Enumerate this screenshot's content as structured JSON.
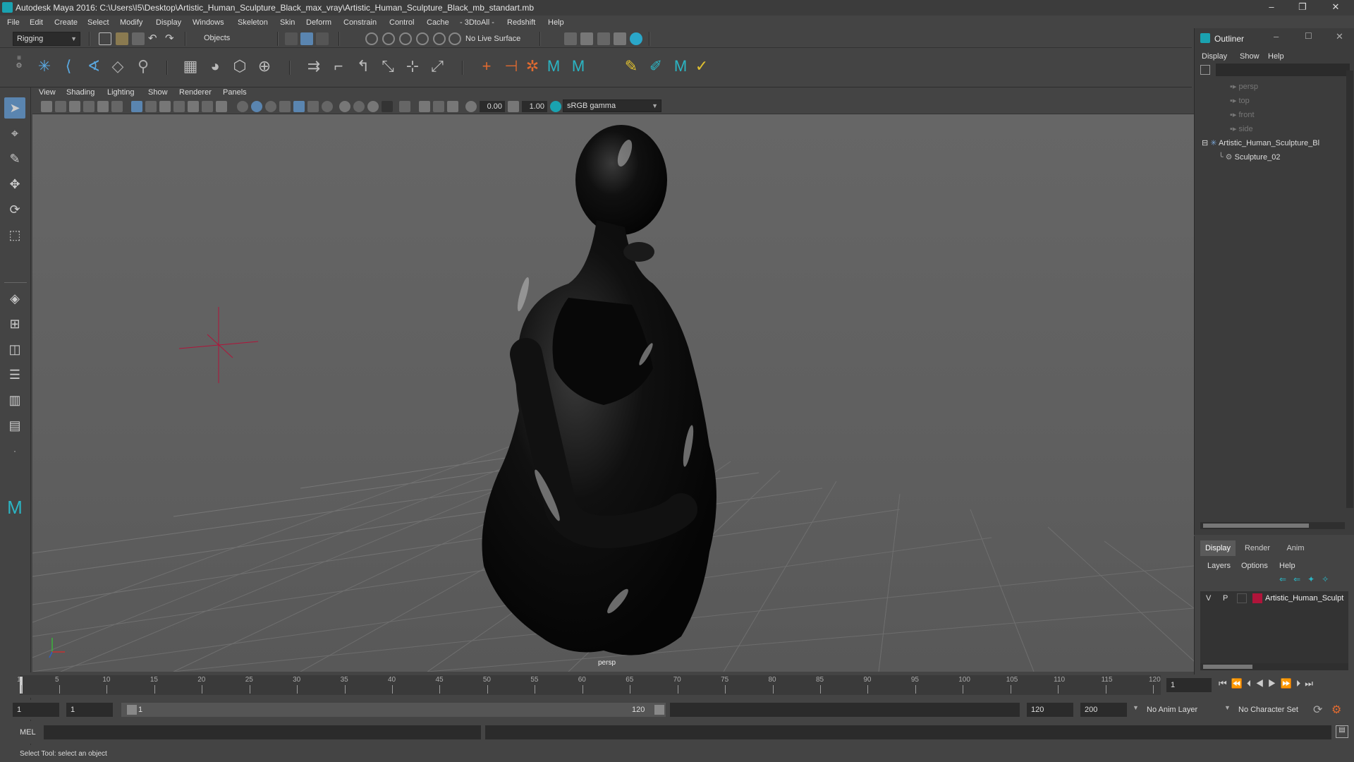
{
  "window": {
    "title": "Autodesk Maya 2016: C:\\Users\\I5\\Desktop\\Artistic_Human_Sculpture_Black_max_vray\\Artistic_Human_Sculpture_Black_mb_standart.mb",
    "minimize": "–",
    "restore": "❐",
    "close": "✕"
  },
  "menubar": [
    "File",
    "Edit",
    "Create",
    "Select",
    "Modify",
    "Display",
    "Windows",
    "Skeleton",
    "Skin",
    "Deform",
    "Constrain",
    "Control",
    "Cache",
    "- 3DtoAll -",
    "Redshift",
    "Help"
  ],
  "statusline": {
    "mode": "Rigging",
    "selection_mode": "Objects",
    "live_surface": "No Live Surface"
  },
  "panel": {
    "menus": [
      "View",
      "Shading",
      "Lighting",
      "Show",
      "Renderer",
      "Panels"
    ],
    "exposure": "0.00",
    "gamma": "1.00",
    "color_space": "sRGB gamma",
    "camera_label": "persp"
  },
  "timeline": {
    "ticks": [
      "1",
      "5",
      "10",
      "15",
      "20",
      "25",
      "30",
      "35",
      "40",
      "45",
      "50",
      "55",
      "60",
      "65",
      "70",
      "75",
      "80",
      "85",
      "90",
      "95",
      "100",
      "105",
      "110",
      "115",
      "120"
    ],
    "current_frame": "1"
  },
  "range": {
    "start": "1",
    "playback_start": "1",
    "slider_start": "1",
    "slider_end": "120",
    "playback_end": "120",
    "end": "200",
    "anim_layer": "No Anim Layer",
    "character_set": "No Character Set"
  },
  "command": {
    "language": "MEL",
    "help": "Select Tool: select an object"
  },
  "outliner": {
    "title": "Outliner",
    "menus": [
      "Display",
      "Show",
      "Help"
    ],
    "items": [
      {
        "label": "persp"
      },
      {
        "label": "top"
      },
      {
        "label": "front"
      },
      {
        "label": "side"
      },
      {
        "label": "Artistic_Human_Sculpture_Bl"
      },
      {
        "label": "Sculpture_02"
      }
    ]
  },
  "layers": {
    "tabs": [
      "Display",
      "Render",
      "Anim"
    ],
    "menus": [
      "Layers",
      "Options",
      "Help"
    ],
    "row": {
      "v": "V",
      "p": "P",
      "name": "Artistic_Human_Sculpt",
      "color": "#b0143a"
    }
  },
  "colors": {
    "accent": "#1aa2b0",
    "active_tool": "#5a85b0",
    "grid_line": "#6d6d6d",
    "sculpture": "#0d0d0d"
  }
}
